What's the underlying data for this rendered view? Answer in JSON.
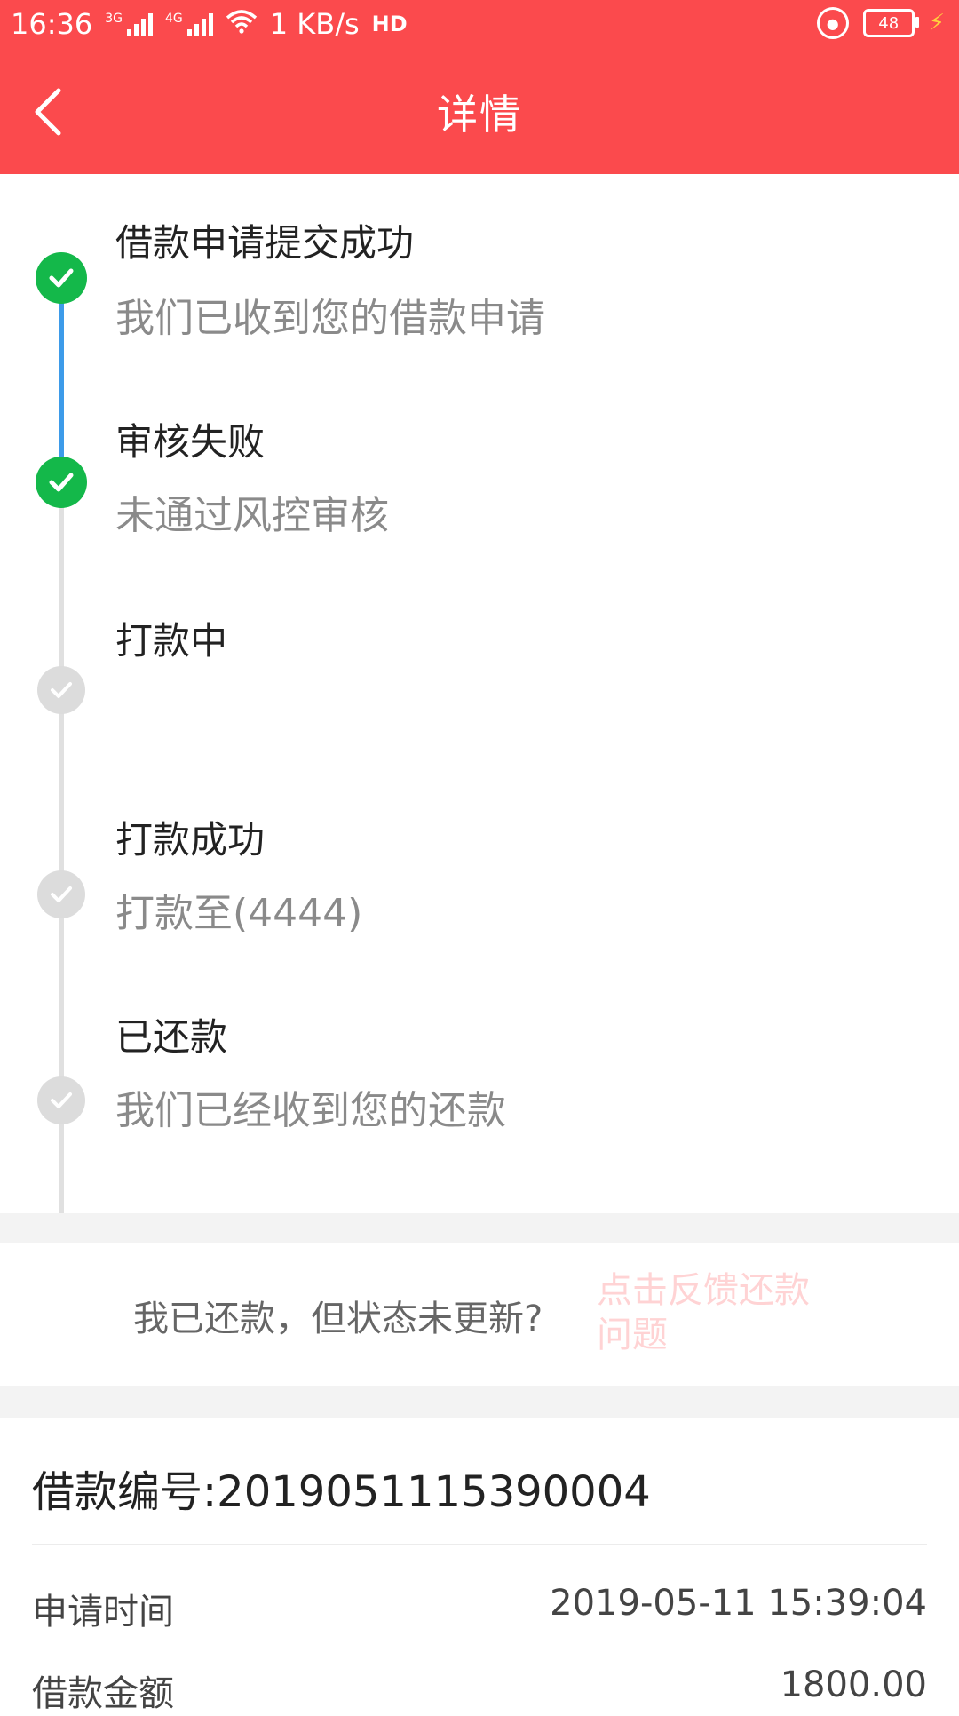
{
  "status_bar": {
    "time": "16:36",
    "net_3g": "3G",
    "net_4g": "4G",
    "speed": "1 KB/s",
    "hd": "HD",
    "battery": "48"
  },
  "header": {
    "title": "详情"
  },
  "timeline": [
    {
      "title": "借款申请提交成功",
      "desc": "我们已收到您的借款申请",
      "state": "done"
    },
    {
      "title": "审核失败",
      "desc": "未通过风控审核",
      "state": "done"
    },
    {
      "title": "打款中",
      "desc": "",
      "state": "pending"
    },
    {
      "title": "打款成功",
      "desc": "打款至(4444)",
      "state": "pending"
    },
    {
      "title": "已还款",
      "desc": "我们已经收到您的还款",
      "state": "pending"
    }
  ],
  "feedback": {
    "question": "我已还款，但状态未更新?",
    "link": "点击反馈还款问题"
  },
  "loan_info": {
    "number_label": "借款编号:2019051115390004",
    "rows": [
      {
        "label": "申请时间",
        "value": "2019-05-11 15:39:04"
      },
      {
        "label": "借款金额",
        "value": "1800.00"
      }
    ]
  },
  "colors": {
    "brand": "#fb4a4d",
    "done": "#14b84a",
    "active_line": "#3d9be9",
    "pending": "#dcdcdc"
  }
}
